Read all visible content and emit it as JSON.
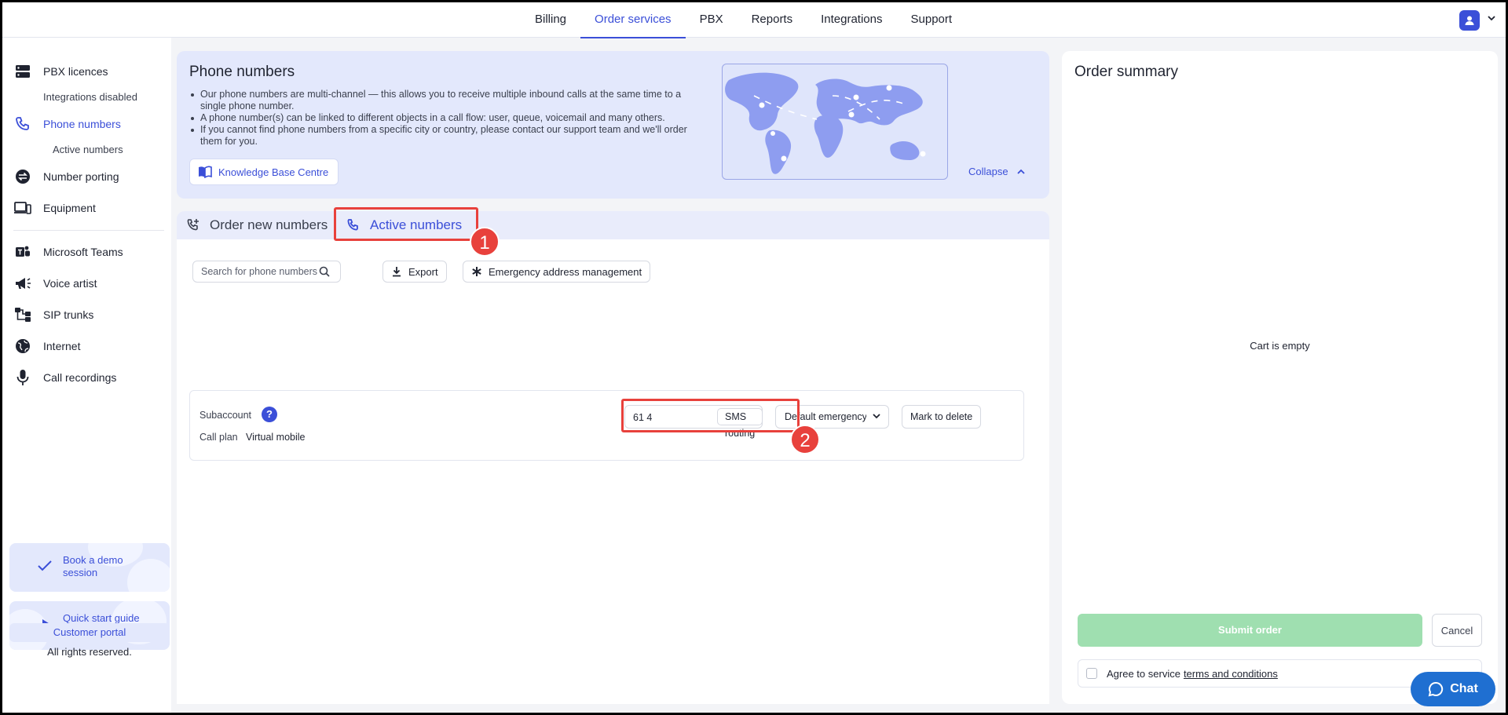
{
  "topnav": {
    "links": [
      "Billing",
      "Order services",
      "PBX",
      "Reports",
      "Integrations",
      "Support"
    ],
    "active_index": 1
  },
  "sidebar": {
    "pbx_licences": "PBX licences",
    "integrations_disabled": "Integrations disabled",
    "phone_numbers": "Phone numbers",
    "active_numbers": "Active numbers",
    "number_porting": "Number porting",
    "equipment": "Equipment",
    "microsoft_teams": "Microsoft Teams",
    "voice_artist": "Voice artist",
    "sip_trunks": "SIP trunks",
    "internet": "Internet",
    "call_recordings": "Call recordings",
    "book_demo": "Book a demo session",
    "quick_start": "Quick start guide",
    "customer_portal": "Customer portal",
    "rights": "All rights reserved."
  },
  "hero": {
    "title": "Phone numbers",
    "bullets": [
      "Our phone numbers are multi-channel — this allows you to receive multiple inbound calls at the same time to a single phone number.",
      "A phone number(s) can be linked to different objects in a call flow: user, queue, voicemail and many others.",
      "If you cannot find phone numbers from a specific city or country, please contact our support team and we'll order them for you."
    ],
    "kb_button": "Knowledge Base Centre",
    "collapse": "Collapse"
  },
  "tabs": {
    "order_new": "Order new numbers",
    "active": "Active numbers"
  },
  "toolbar": {
    "search_placeholder": "Search for phone numbers",
    "export": "Export",
    "emergency": "Emergency address management"
  },
  "number_row": {
    "subaccount_label": "Subaccount",
    "help": "?",
    "call_plan_label": "Call plan",
    "call_plan_value": "Virtual mobile",
    "number": "61 4",
    "sms_routing": "SMS routing",
    "emergency_dropdown": "Default emergency",
    "mark_delete": "Mark to delete"
  },
  "annotations": {
    "badge1": "1",
    "badge2": "2",
    "color": "#e8413c"
  },
  "summary": {
    "title": "Order summary",
    "cart_empty": "Cart is empty",
    "submit": "Submit order",
    "cancel": "Cancel",
    "agree_prefix": "Agree to service",
    "terms": "terms and conditions"
  },
  "chat": {
    "label": "Chat"
  },
  "colors": {
    "accent": "#3b4fd8",
    "submit_disabled": "#9fdfb0",
    "chat": "#1f6fd1"
  }
}
